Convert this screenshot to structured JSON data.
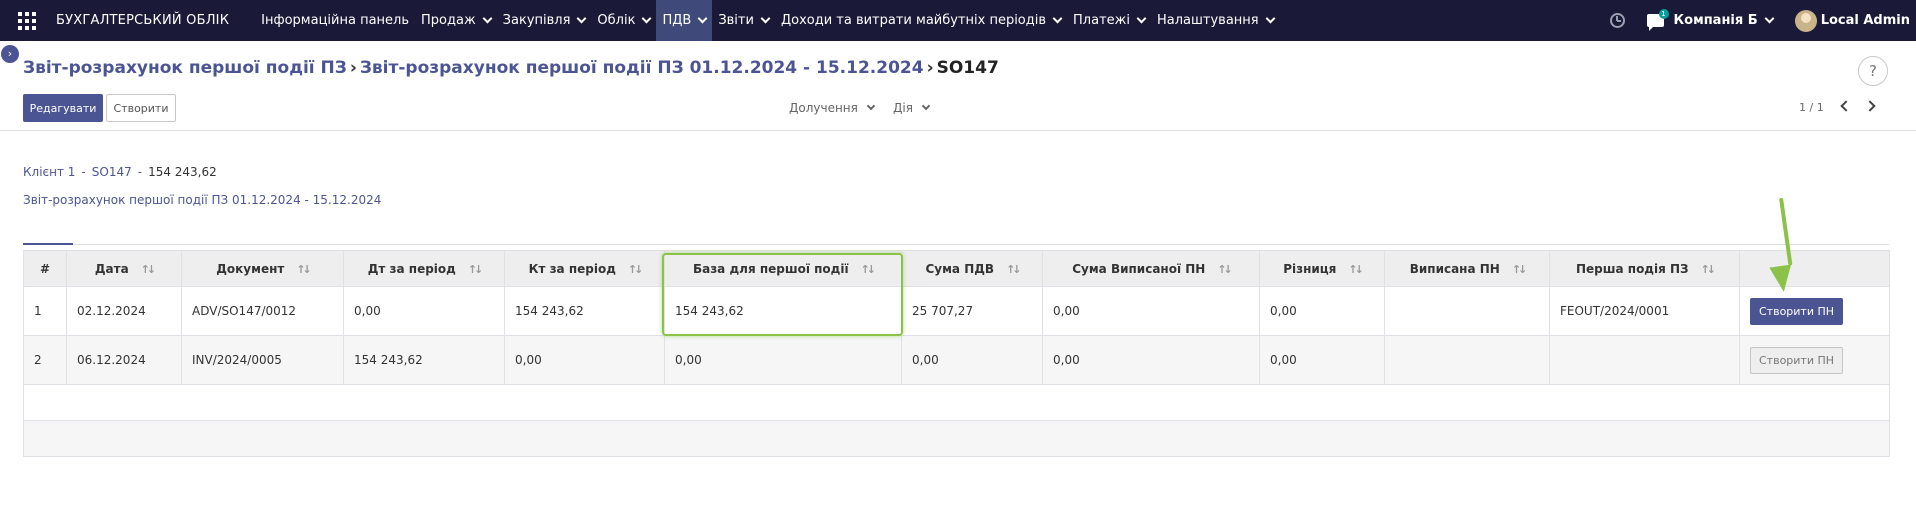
{
  "nav": {
    "brand": "БУХГАЛТЕРСЬКИЙ ОБЛІК",
    "menu": [
      {
        "label": "Інформаційна панель",
        "dropdown": false
      },
      {
        "label": "Продаж",
        "dropdown": true
      },
      {
        "label": "Закупівля",
        "dropdown": true
      },
      {
        "label": "Облік",
        "dropdown": true
      },
      {
        "label": "ПДВ",
        "dropdown": true,
        "active": true
      },
      {
        "label": "Звіти",
        "dropdown": true
      },
      {
        "label": "Доходи та витрати майбутніх періодів",
        "dropdown": true
      },
      {
        "label": "Платежі",
        "dropdown": true
      },
      {
        "label": "Налаштування",
        "dropdown": true
      }
    ],
    "chat_badge": "1",
    "company": "Компанія Б",
    "user": "Local Admin",
    "bg_color": "#1a1a38",
    "active_color": "#3f4a7a"
  },
  "breadcrumb": {
    "item1": "Звіт-розрахунок першої події ПЗ",
    "item2": "Звіт-розрахунок першої події ПЗ 01.12.2024 - 15.12.2024",
    "current": "SO147",
    "separator": "›"
  },
  "help_label": "?",
  "toolbar": {
    "edit_label": "Редагувати",
    "create_label": "Створити",
    "attachments_label": "Долучення",
    "action_label": "Дія",
    "pager": "1 / 1"
  },
  "info": {
    "client": "Клієнт 1",
    "order": "SO147",
    "separator": "-",
    "amount": "154 243,62",
    "report": "Звіт-розрахунок першої події ПЗ 01.12.2024 - 15.12.2024"
  },
  "table": {
    "headers": [
      "#",
      "Дата",
      "Документ",
      "Дт за період",
      "Кт за період",
      "База для першої події",
      "Сума ПДВ",
      "Сума Виписаної ПН",
      "Різниця",
      "Виписана ПН",
      "Перша подія ПЗ",
      ""
    ],
    "rows": [
      {
        "num": "1",
        "date": "02.12.2024",
        "doc": "ADV/SO147/0012",
        "dt": "0,00",
        "kt": "154 243,62",
        "base": "154 243,62",
        "vat": "25 707,27",
        "issued_sum": "0,00",
        "diff": "0,00",
        "issued": "",
        "first_event": "FEOUT/2024/0001",
        "action": "Створити ПН",
        "action_enabled": true
      },
      {
        "num": "2",
        "date": "06.12.2024",
        "doc": "INV/2024/0005",
        "dt": "154 243,62",
        "kt": "0,00",
        "base": "0,00",
        "vat": "0,00",
        "issued_sum": "0,00",
        "diff": "0,00",
        "issued": "",
        "first_event": "",
        "action": "Створити ПН",
        "action_enabled": false
      }
    ]
  },
  "colors": {
    "accent": "#4c5593",
    "highlight": "#8bc34a"
  }
}
